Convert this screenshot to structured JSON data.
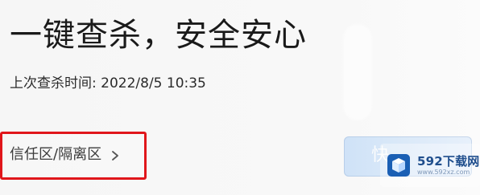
{
  "security_panel": {
    "title": "一键查杀，安全安心",
    "last_scan_label": "上次查杀时间: 2022/8/5 10:35",
    "trust_quarantine_link": "信任区/隔离区",
    "scan_button_partial_label": "快"
  },
  "watermark": {
    "text": "592下载网",
    "url": "www.592xz.com"
  },
  "colors": {
    "highlight_border": "#e0161b",
    "scan_button_bg": "#d9e8f8",
    "watermark_blue": "#1f4e8d"
  },
  "icons": {
    "chevron": "chevron-right-icon",
    "watermark_logo": "cube-logo-icon"
  }
}
